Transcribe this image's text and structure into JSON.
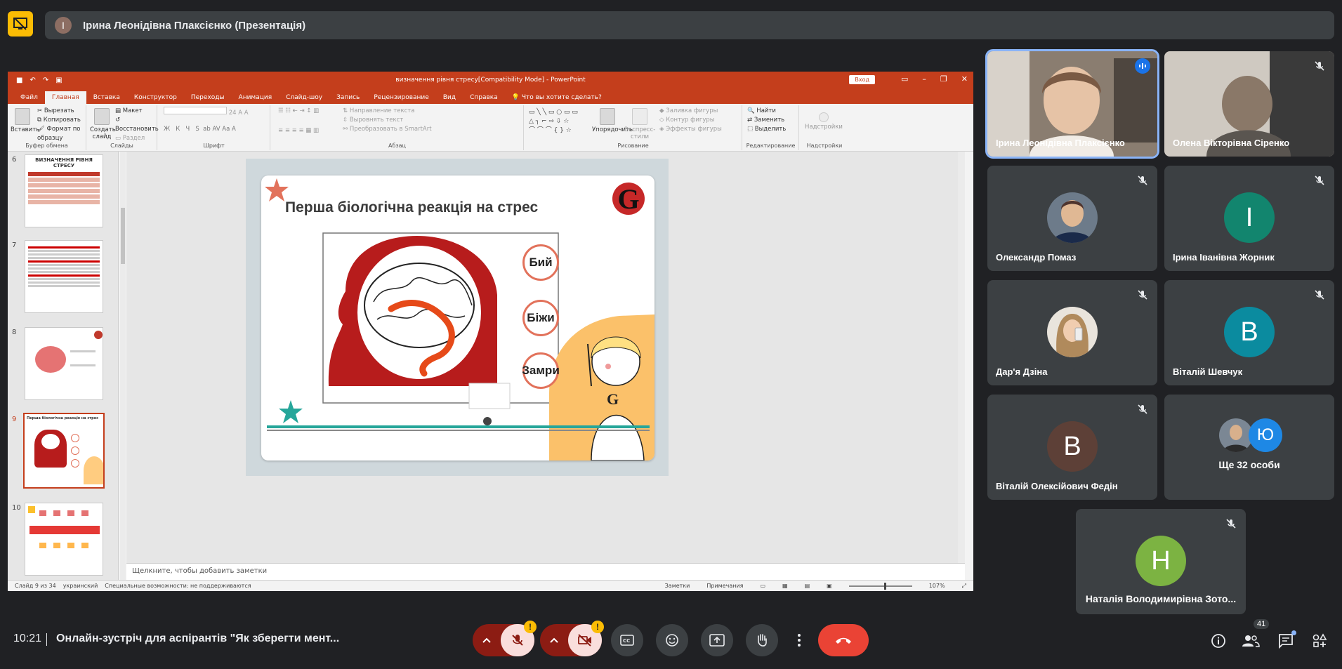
{
  "meeting": {
    "presenter_initial": "I",
    "presenter_label": "Ірина Леонідівна Плаксієнко (Презентація)",
    "clock": "10:21",
    "title": "Онлайн-зустріч для аспірантів \"Як зберегти мент...",
    "people_count": "41"
  },
  "ppt": {
    "doc_title": "визначення рівня стресу[Compatibility Mode] - PowerPoint",
    "login_label": "Вход",
    "tabs": [
      "Файл",
      "Главная",
      "Вставка",
      "Конструктор",
      "Переходы",
      "Анимация",
      "Слайд-шоу",
      "Запись",
      "Рецензирование",
      "Вид",
      "Справка"
    ],
    "tell_me": "Что вы хотите сделать?",
    "ribbon": {
      "clipboard": {
        "label": "Буфер обмена",
        "paste": "Вставить",
        "cut": "Вырезать",
        "copy": "Копировать",
        "format_painter": "Формат по образцу"
      },
      "slides": {
        "label": "Слайды",
        "new_slide": "Создать слайд",
        "layout": "Макет",
        "reset": "Восстановить",
        "section": "Раздел"
      },
      "font": {
        "label": "Шрифт",
        "size": "24",
        "bold": "Ж",
        "italic": "К",
        "underline": "Ч",
        "strike": "S"
      },
      "paragraph": {
        "label": "Абзац",
        "text_direction": "Направление текста",
        "align_text": "Выровнять текст",
        "smartart": "Преобразовать в SmartArt"
      },
      "drawing": {
        "label": "Рисование",
        "arrange": "Упорядочить",
        "quick_styles": "Экспресс-стили",
        "fill": "Заливка фигуры",
        "outline": "Контур фигуры",
        "effects": "Эффекты фигуры"
      },
      "editing": {
        "label": "Редактирование",
        "find": "Найти",
        "replace": "Заменить",
        "select": "Выделить"
      },
      "addins": {
        "label": "Надстройки",
        "button": "Надстройки"
      }
    },
    "thumbnails": [
      {
        "num": "6",
        "title": "ВИЗНАЧЕННЯ РІВНЯ СТРЕСУ"
      },
      {
        "num": "7",
        "title": ""
      },
      {
        "num": "8",
        "title": ""
      },
      {
        "num": "9",
        "title": "Перша біологічна реакція на стрес"
      },
      {
        "num": "10",
        "title": ""
      }
    ],
    "slide": {
      "heading": "Перша біологічна реакція на стрес",
      "bubbles": [
        "Бий",
        "Біжи",
        "Замри"
      ],
      "logo": "G"
    },
    "notes_placeholder": "Щелкните, чтобы добавить заметки",
    "status": {
      "slide_info": "Слайд 9 из 34",
      "language": "украинский",
      "accessibility": "Специальные возможности: не поддерживаются",
      "notes": "Заметки",
      "comments": "Примечания",
      "zoom": "107%"
    }
  },
  "participants": [
    {
      "name": "Ірина Леонідівна Плаксієнко",
      "type": "video",
      "speaking": true
    },
    {
      "name": "Олена Вікторівна Сіренко",
      "type": "video",
      "speaking": false
    },
    {
      "name": "Олександр Помаз",
      "type": "photo"
    },
    {
      "name": "Ірина Іванівна Жорник",
      "type": "letter",
      "letter": "I",
      "color": "#12856e"
    },
    {
      "name": "Дар'я Дзіна",
      "type": "photo"
    },
    {
      "name": "Віталій Шевчук",
      "type": "letter",
      "letter": "В",
      "color": "#0b8b9f"
    },
    {
      "name": "Віталій Олексійович Федін",
      "type": "letter",
      "letter": "В",
      "color": "#5d4037"
    },
    {
      "name": "Ще 32 особи",
      "type": "group",
      "letter": "Ю",
      "color": "#1e88e5"
    },
    {
      "name": "Наталія Володимирівна Зото...",
      "type": "letter",
      "letter": "Н",
      "color": "#7cb342"
    }
  ],
  "colors": {
    "accent": "#8ab4f8",
    "hangup": "#ea4335",
    "ppt_red": "#c43e1c",
    "warning": "#fbbc04"
  },
  "controls": [
    "mic-off",
    "camera-off",
    "captions",
    "emoji",
    "present",
    "raise-hand",
    "more",
    "hangup"
  ],
  "side_controls": [
    "info",
    "people",
    "chat",
    "activities"
  ]
}
